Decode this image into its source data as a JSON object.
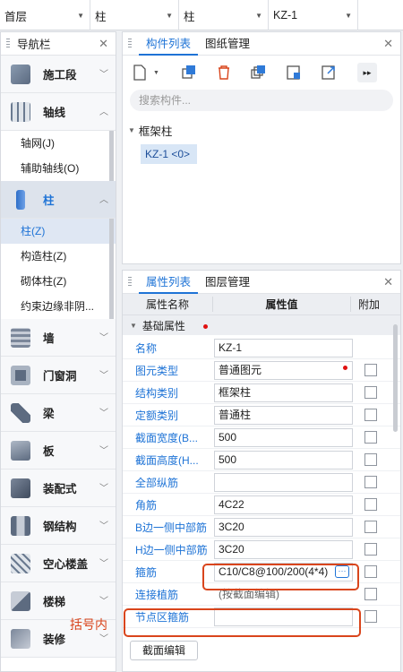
{
  "topbar": {
    "floor": "首层",
    "category": "柱",
    "type": "柱",
    "element": "KZ-1"
  },
  "nav": {
    "title": "导航栏",
    "items": [
      {
        "label": "施工段",
        "state": "collapsed"
      },
      {
        "label": "轴线",
        "state": "expanded",
        "children": [
          "轴网(J)",
          "辅助轴线(O)"
        ]
      },
      {
        "label": "柱",
        "state": "expanded",
        "children": [
          "柱(Z)",
          "构造柱(Z)",
          "砌体柱(Z)",
          "约束边缘非阴..."
        ]
      },
      {
        "label": "墙"
      },
      {
        "label": "门窗洞"
      },
      {
        "label": "梁"
      },
      {
        "label": "板"
      },
      {
        "label": "装配式"
      },
      {
        "label": "钢结构"
      },
      {
        "label": "空心楼盖"
      },
      {
        "label": "楼梯"
      },
      {
        "label": "装修"
      }
    ]
  },
  "component_panel": {
    "tabs": [
      "构件列表",
      "图纸管理"
    ],
    "search_placeholder": "搜索构件...",
    "tree_group": "框架柱",
    "tree_item": "KZ-1 <0>"
  },
  "property_panel": {
    "tabs": [
      "属性列表",
      "图层管理"
    ],
    "headers": [
      "属性名称",
      "属性值",
      "附加"
    ],
    "group": "基础属性",
    "rows": [
      {
        "name": "名称",
        "value": "KZ-1"
      },
      {
        "name": "图元类型",
        "value": "普通图元"
      },
      {
        "name": "结构类别",
        "value": "框架柱"
      },
      {
        "name": "定额类别",
        "value": "普通柱"
      },
      {
        "name": "截面宽度(B...",
        "value": "500"
      },
      {
        "name": "截面高度(H...",
        "value": "500"
      },
      {
        "name": "全部纵筋",
        "value": ""
      },
      {
        "name": "角筋",
        "value": "4C22"
      },
      {
        "name": "B边一侧中部筋",
        "value": "3C20"
      },
      {
        "name": "H边一侧中部筋",
        "value": "3C20"
      },
      {
        "name": "箍筋",
        "value": "C10/C8@100/200(4*4)"
      },
      {
        "name": "连接植筋",
        "value": "(按截面编辑)"
      },
      {
        "name": "节点区箍筋",
        "value": ""
      }
    ],
    "annotation": "括号内",
    "edit_button": "截面编辑"
  },
  "colors": {
    "accent": "#1e73d6",
    "highlight": "#d9451c"
  }
}
